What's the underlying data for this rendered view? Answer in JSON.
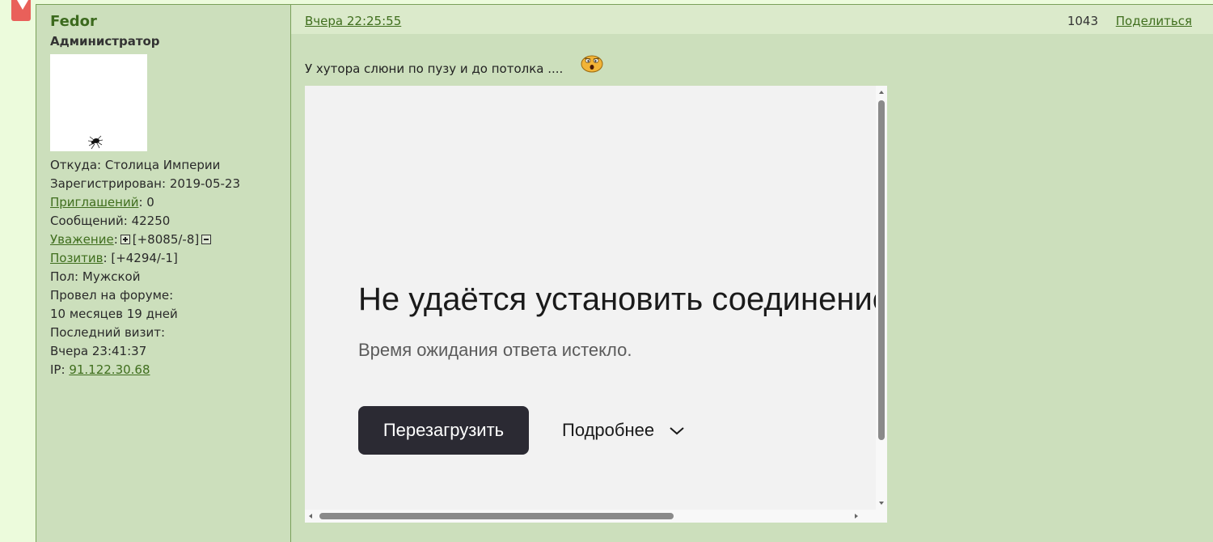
{
  "author": {
    "name": "Fedor",
    "role": "Администратор",
    "from_label": "Откуда:",
    "from_value": "Столица Империи",
    "registered_label": "Зарегистрирован:",
    "registered_value": "2019-05-23",
    "invites_label": "Приглашений",
    "invites_value": ": 0",
    "messages_label": "Сообщений:",
    "messages_value": "42250",
    "respect_label": "Уважение",
    "respect_value": "[+8085/-8]",
    "positive_label": "Позитив",
    "positive_value": ": [+4294/-1]",
    "gender_label": "Пол:",
    "gender_value": "Мужской",
    "time_on_forum_label": "Провел на форуме:",
    "time_on_forum_value": "10 месяцев 19 дней",
    "last_visit_label": "Последний визит:",
    "last_visit_value": "Вчера 23:41:37",
    "ip_label": "IP:",
    "ip_value": "91.122.30.68"
  },
  "post": {
    "date": "Вчера 22:25:55",
    "number": "1043",
    "share_label": "Поделиться",
    "text": "У хутора слюни по пузу и до потолка ...."
  },
  "embed_error": {
    "title": "Не удаётся установить соединение",
    "subtitle": "Время ожидания ответа истекло.",
    "reload_label": "Перезагрузить",
    "details_label": "Подробнее"
  },
  "colors": {
    "page_bg": "#ecfbdc",
    "post_bg": "#ccdfbc",
    "header_bg": "#dbeacb",
    "link": "#3f6e1d",
    "author_name": "#3c6a1e",
    "button_dark": "#2b2a33"
  },
  "icons": [
    "bookmark-icon",
    "spider-icon",
    "plus-icon",
    "minus-icon",
    "smiley-icon",
    "chevron-down-icon"
  ]
}
